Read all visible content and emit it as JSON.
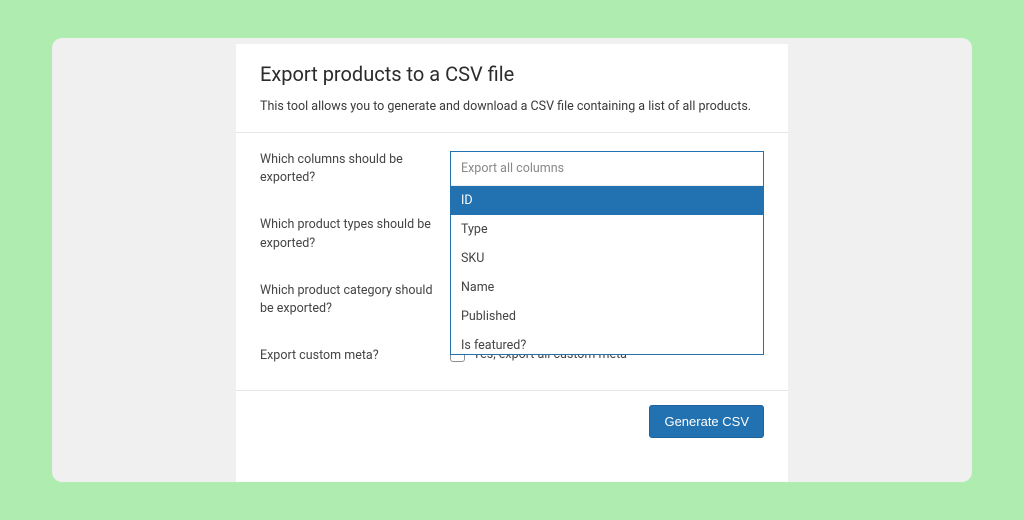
{
  "header": {
    "title": "Export products to a CSV file",
    "description": "This tool allows you to generate and download a CSV file containing a list of all products."
  },
  "form": {
    "columns": {
      "label": "Which columns should be exported?",
      "placeholder": "Export all columns",
      "options": [
        "ID",
        "Type",
        "SKU",
        "Name",
        "Published",
        "Is featured?"
      ],
      "highlighted_index": 0
    },
    "types": {
      "label": "Which product types should be exported?"
    },
    "category": {
      "label": "Which product category should be exported?"
    },
    "custom_meta": {
      "label": "Export custom meta?",
      "checkbox_label": "Yes, export all custom meta"
    }
  },
  "footer": {
    "submit_label": "Generate CSV"
  }
}
